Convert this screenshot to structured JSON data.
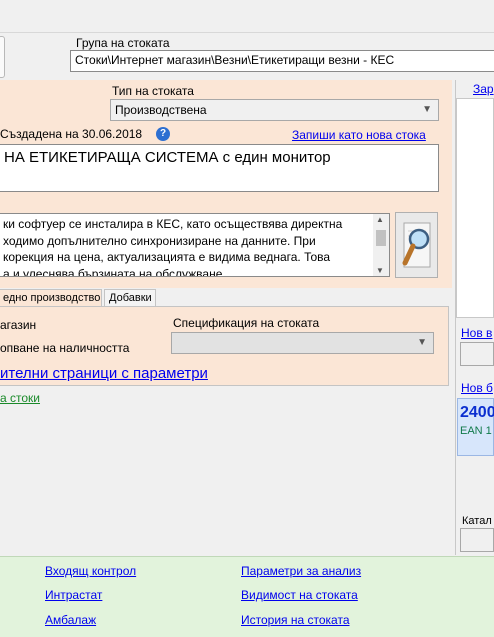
{
  "group": {
    "label": "Група на стоката",
    "value": "Стоки\\Интернет магазин\\Везни\\Етикетиращи везни - КЕС"
  },
  "type": {
    "label": "Тип на стоката",
    "value": "Производствена"
  },
  "created": {
    "text": "Създадена на 30.06.2018"
  },
  "save_as_new": "Запиши като нова стока",
  "product_name": "НА ЕТИКЕТИРАЩА СИСТЕМА с един монитор",
  "description": {
    "lines": [
      "ки софтуер се инсталира в КЕС, като осъществява директна",
      "ходимо допълнително синхронизиране на данните. При",
      " корекция на цена, актуализацията е  видима веднага. Това",
      "а и улеснява бързината на обслужване."
    ]
  },
  "tabs": [
    {
      "label": "едно производство"
    },
    {
      "label": "Добавки"
    }
  ],
  "panel": {
    "magazin": "агазин",
    "opening": "опване на наличността",
    "spec_label": "Спецификация на стоката",
    "spec_value": ""
  },
  "additional_pages": "ителни страници с параметри",
  "stoki_link": "а стоки",
  "right": {
    "top_link": "Зар",
    "nov1": "Нов в",
    "nov2": "Нов б",
    "barcode": "2400",
    "ean": "EAN 1",
    "katalog": "Катал"
  },
  "footer": {
    "incoming_control": "Входящ контрол",
    "intrastat": "Интрастат",
    "packaging": "Амбалаж",
    "analysis_params": "Параметри за анализ",
    "visibility": "Видимост на стоката",
    "history": "История на стоката"
  },
  "colors": {
    "peach": "#fbe6d6",
    "link": "#0000ee",
    "footer_green": "#e2f3dc",
    "barcode_blue": "#0b2fd0"
  }
}
